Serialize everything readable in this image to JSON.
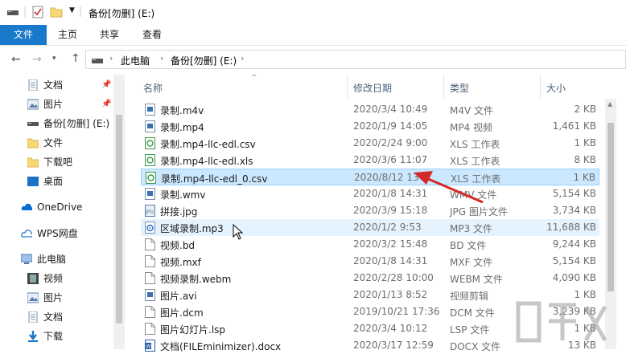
{
  "window": {
    "title": "备份[勿删] (E:)"
  },
  "ribbon": {
    "tabs": [
      {
        "label": "文件"
      },
      {
        "label": "主页"
      },
      {
        "label": "共享"
      },
      {
        "label": "查看"
      }
    ]
  },
  "address": {
    "crumbs": [
      "此电脑",
      "备份[勿删] (E:)"
    ]
  },
  "nav": {
    "items": [
      {
        "label": "文档",
        "icon": "document-icon",
        "pinned": true
      },
      {
        "label": "图片",
        "icon": "picture-icon",
        "pinned": true
      },
      {
        "label": "备份[勿删] (E:)",
        "icon": "drive-icon",
        "pinned": false
      },
      {
        "label": "文件",
        "icon": "folder-icon",
        "pinned": false
      },
      {
        "label": "下载吧",
        "icon": "folder-icon",
        "pinned": false
      },
      {
        "label": "桌面",
        "icon": "desktop-icon",
        "pinned": false
      },
      {
        "label": "OneDrive",
        "icon": "cloud-icon",
        "pinned": false
      },
      {
        "label": "WPS网盘",
        "icon": "cloud-icon",
        "pinned": false
      },
      {
        "label": "此电脑",
        "icon": "computer-icon",
        "pinned": false
      },
      {
        "label": "视频",
        "icon": "video-icon",
        "pinned": false
      },
      {
        "label": "图片",
        "icon": "picture-icon",
        "pinned": false
      },
      {
        "label": "文档",
        "icon": "document-icon",
        "pinned": false
      },
      {
        "label": "下载",
        "icon": "download-icon",
        "pinned": false
      }
    ]
  },
  "columns": {
    "name": "名称",
    "date": "修改日期",
    "type": "类型",
    "size": "大小"
  },
  "files": [
    {
      "name": "录制.m4v",
      "date": "2020/3/4 10:49",
      "type": "M4V 文件",
      "size": "2 KB",
      "icon": "video-file-icon"
    },
    {
      "name": "录制.mp4",
      "date": "2020/1/9 14:05",
      "type": "MP4 视频",
      "size": "1,461 KB",
      "icon": "video-file-icon"
    },
    {
      "name": "录制.mp4-llc-edl.csv",
      "date": "2020/2/24 9:00",
      "type": "XLS 工作表",
      "size": "1 KB",
      "icon": "sheet-file-icon"
    },
    {
      "name": "录制.mp4-llc-edl.xls",
      "date": "2020/3/6 11:07",
      "type": "XLS 工作表",
      "size": "8 KB",
      "icon": "sheet-file-icon"
    },
    {
      "name": "录制.mp4-llc-edl_0.csv",
      "date": "2020/8/12 13",
      "type": "XLS 工作表",
      "size": "1 KB",
      "icon": "sheet-file-icon"
    },
    {
      "name": "录制.wmv",
      "date": "2020/1/8 14:31",
      "type": "WMV 文件",
      "size": "5,154 KB",
      "icon": "video-file-icon"
    },
    {
      "name": "拼接.jpg",
      "date": "2020/3/9 15:18",
      "type": "JPG 图片文件",
      "size": "3,734 KB",
      "icon": "image-file-icon"
    },
    {
      "name": "区域录制.mp3",
      "date": "2020/1/2 9:53",
      "type": "MP3 文件",
      "size": "11,688 KB",
      "icon": "audio-file-icon"
    },
    {
      "name": "视频.bd",
      "date": "2020/3/2 15:48",
      "type": "BD 文件",
      "size": "9,244 KB",
      "icon": "blank-file-icon"
    },
    {
      "name": "视频.mxf",
      "date": "2020/1/8 14:31",
      "type": "MXF 文件",
      "size": "5,154 KB",
      "icon": "blank-file-icon"
    },
    {
      "name": "视频录制.webm",
      "date": "2020/2/28 10:00",
      "type": "WEBM 文件",
      "size": "4,090 KB",
      "icon": "blank-file-icon"
    },
    {
      "name": "图片.avi",
      "date": "2020/1/13 8:52",
      "type": "视频剪辑",
      "size": "1 KB",
      "icon": "video-file-icon"
    },
    {
      "name": "图片.dcm",
      "date": "2019/10/21 17:36",
      "type": "DCM 文件",
      "size": "3,239 KB",
      "icon": "blank-file-icon"
    },
    {
      "name": "图片幻灯片.lsp",
      "date": "2020/3/4 10:12",
      "type": "LSP 文件",
      "size": "1 KB",
      "icon": "blank-file-icon"
    },
    {
      "name": "文档(FILEminimizer).docx",
      "date": "2020/3/17 12:59",
      "type": "DOCX 文件",
      "size": "13 KB",
      "icon": "word-file-icon"
    }
  ],
  "state": {
    "selected_row": 4,
    "hover_row": 7
  },
  "colors": {
    "accent": "#1979ca",
    "selected": "#cce8ff",
    "arrow": "#d42a2a",
    "folder": "#f8d775"
  }
}
